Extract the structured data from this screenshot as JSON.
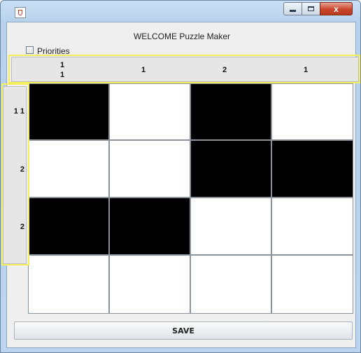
{
  "window": {
    "title": "",
    "controls": {
      "minimize_icon": "minimize-icon",
      "maximize_icon": "maximize-icon",
      "close_label": "x"
    }
  },
  "header": {
    "welcome": "WELCOME Puzzle Maker"
  },
  "options": {
    "priorities_label": "Priorities",
    "priorities_checked": false
  },
  "column_clues": [
    [
      "1",
      "1"
    ],
    [
      "1"
    ],
    [
      "2"
    ],
    [
      "1"
    ]
  ],
  "row_clues": [
    "1 1",
    "2",
    "2"
  ],
  "grid": {
    "rows": 4,
    "cols": 4,
    "cells": [
      [
        1,
        0,
        1,
        0
      ],
      [
        0,
        0,
        1,
        1
      ],
      [
        1,
        1,
        0,
        0
      ],
      [
        0,
        0,
        0,
        0
      ]
    ],
    "filled_color": "#000000",
    "empty_color": "#ffffff",
    "line_color": "#8a939c"
  },
  "highlight_color": "#f3ef5a",
  "save_label": "SAVE"
}
